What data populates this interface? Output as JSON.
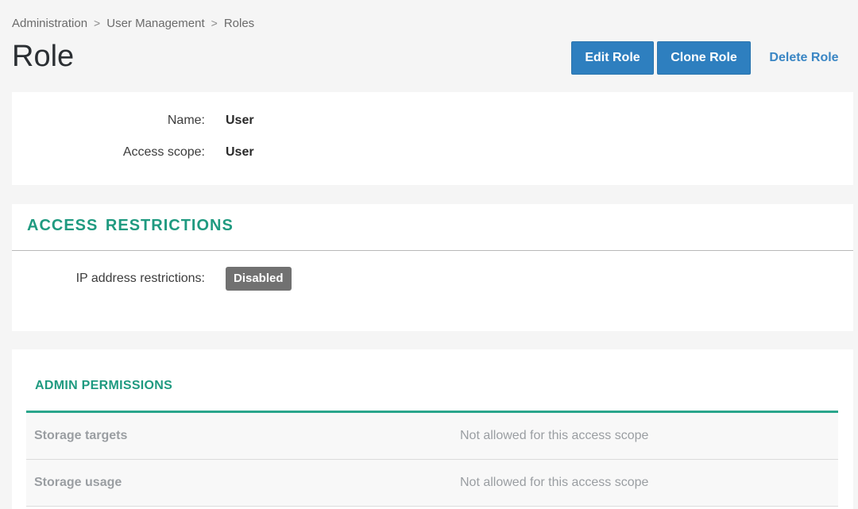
{
  "breadcrumb": {
    "items": [
      "Administration",
      "User Management",
      "Roles"
    ],
    "separator": ">"
  },
  "page": {
    "title": "Role"
  },
  "actions": {
    "edit": "Edit Role",
    "clone": "Clone Role",
    "delete": "Delete Role"
  },
  "info": {
    "name_label": "Name:",
    "name_value": "User",
    "scope_label": "Access scope:",
    "scope_value": "User"
  },
  "access_restrictions": {
    "title": "ACCESS RESTRICTIONS",
    "ip_label": "IP address restrictions:",
    "ip_status": "Disabled"
  },
  "admin_permissions": {
    "title": "ADMIN PERMISSIONS",
    "rows": [
      {
        "permission": "Storage targets",
        "status": "Not allowed for this access scope"
      },
      {
        "permission": "Storage usage",
        "status": "Not allowed for this access scope"
      }
    ]
  },
  "colors": {
    "primary_button": "#2e7fbf",
    "link": "#3a86c4",
    "section_title": "#1f9a80",
    "table_accent": "#2aa68c",
    "badge_disabled": "#717171",
    "background": "#f5f5f5"
  },
  "icons": {
    "breadcrumb_separator": "chevron-right-icon"
  }
}
